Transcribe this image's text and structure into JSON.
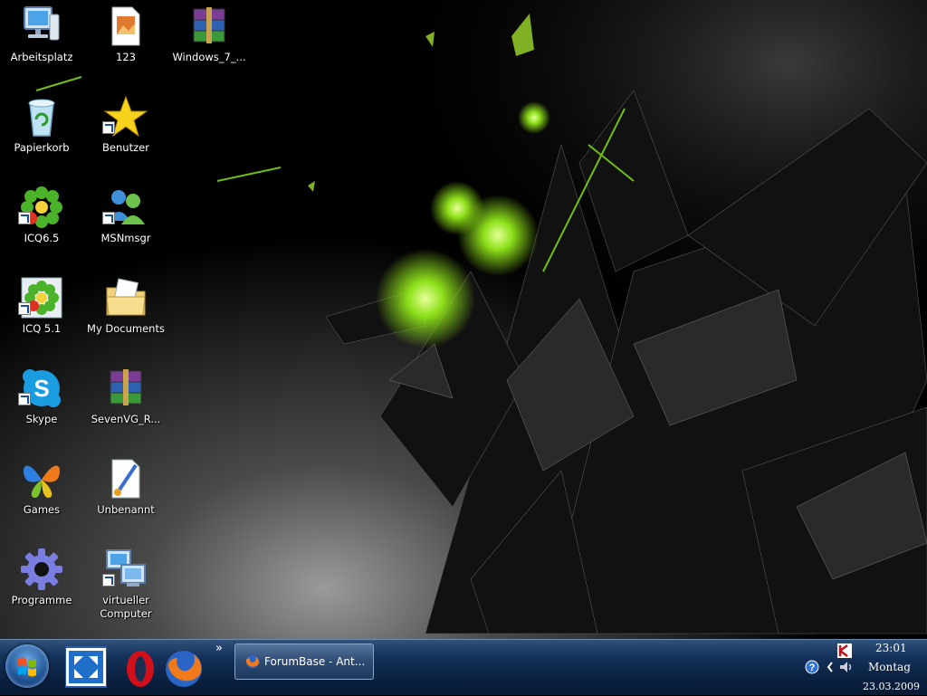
{
  "desktop": {
    "icons": [
      {
        "label": "Arbeitsplatz",
        "icon": "computer-icon"
      },
      {
        "label": "123",
        "icon": "document-icon"
      },
      {
        "label": "Windows_7_...",
        "icon": "archive-icon"
      },
      {
        "label": "Papierkorb",
        "icon": "recycle-bin-icon"
      },
      {
        "label": "Benutzer",
        "icon": "star-icon"
      },
      {
        "label": "ICQ6.5",
        "icon": "icq-flower-icon"
      },
      {
        "label": "MSNmsgr",
        "icon": "msn-messenger-icon"
      },
      {
        "label": "ICQ 5.1",
        "icon": "icq-flower-icon"
      },
      {
        "label": "My Documents",
        "icon": "documents-folder-icon"
      },
      {
        "label": "Skype",
        "icon": "skype-icon"
      },
      {
        "label": "SevenVG_R...",
        "icon": "archive-icon"
      },
      {
        "label": "Games",
        "icon": "games-butterfly-icon"
      },
      {
        "label": "Unbenannt",
        "icon": "paint-document-icon"
      },
      {
        "label": "Programme",
        "icon": "gear-icon"
      },
      {
        "label": "virtueller Computer",
        "icon": "virtual-pc-icon"
      }
    ]
  },
  "taskbar": {
    "start_icon": "windows-orb-icon",
    "quick_launch": [
      {
        "icon": "show-desktop-icon"
      },
      {
        "icon": "opera-icon"
      },
      {
        "icon": "firefox-icon"
      }
    ],
    "overflow": "»",
    "task": {
      "label": "ForumBase - Ant...",
      "icon": "firefox-icon"
    },
    "tray": {
      "icons": [
        "kaspersky-icon",
        "help-icon",
        "chevron-left-icon",
        "volume-icon"
      ],
      "time": "23:01",
      "day": "Montag",
      "date": "23.03.2009"
    }
  },
  "colors": {
    "accent": "#7fd400",
    "taskbar": "#0c2446"
  }
}
